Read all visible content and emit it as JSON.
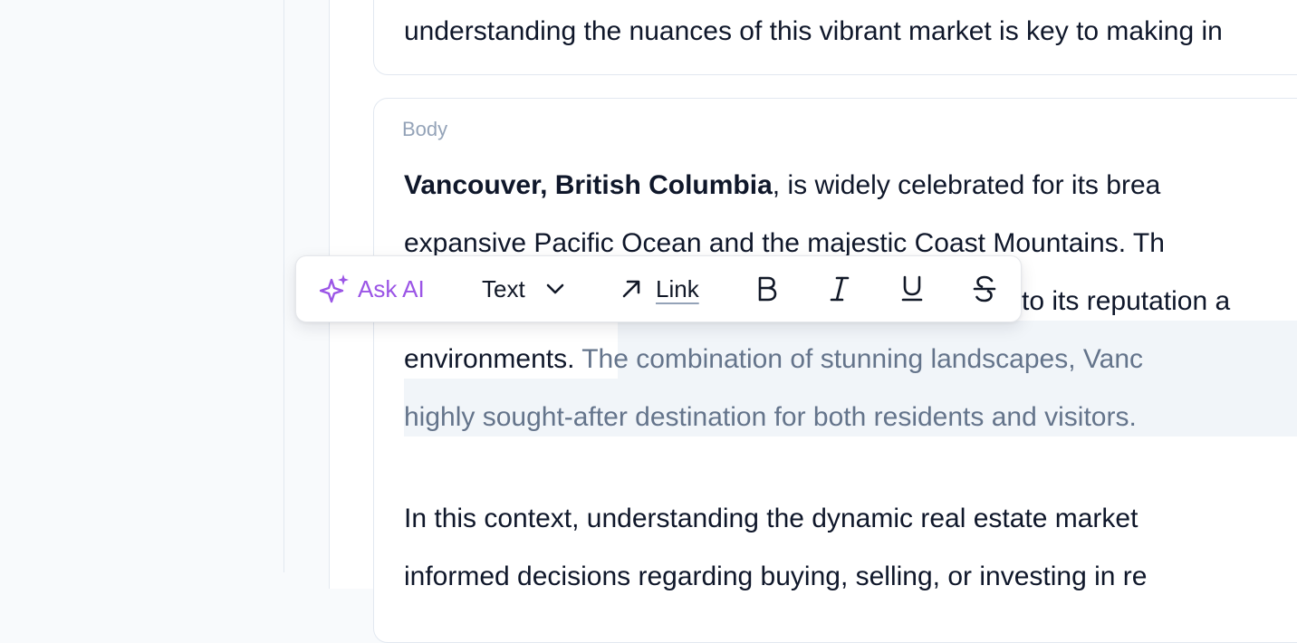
{
  "top_card": {
    "line_fragment": "understanding the nuances of this vibrant market is key to making in"
  },
  "body_card": {
    "label": "Body",
    "line1_bold": "Vancouver, British Columbia",
    "line1_rest": ", is widely celebrated for its brea",
    "line2": "expansive Pacific Ocean and the majestic Coast Mountains. Th",
    "line3_tail": "es to its reputation a",
    "line4_plain": "environments. ",
    "line4_selected": "The combination of stunning landscapes, Vanc",
    "line5_selected": "highly sought-after destination for both residents and visitors.",
    "line6": "In this context, understanding the dynamic real estate market",
    "line7": "informed decisions regarding buying, selling, or investing in re"
  },
  "toolbar": {
    "ask_ai_label": "Ask AI",
    "text_label": "Text",
    "link_label": "Link"
  },
  "colors": {
    "ai_accent": "#9b55e6",
    "selection_text": "#64748b",
    "selection_bg": "#f1f5f9"
  }
}
